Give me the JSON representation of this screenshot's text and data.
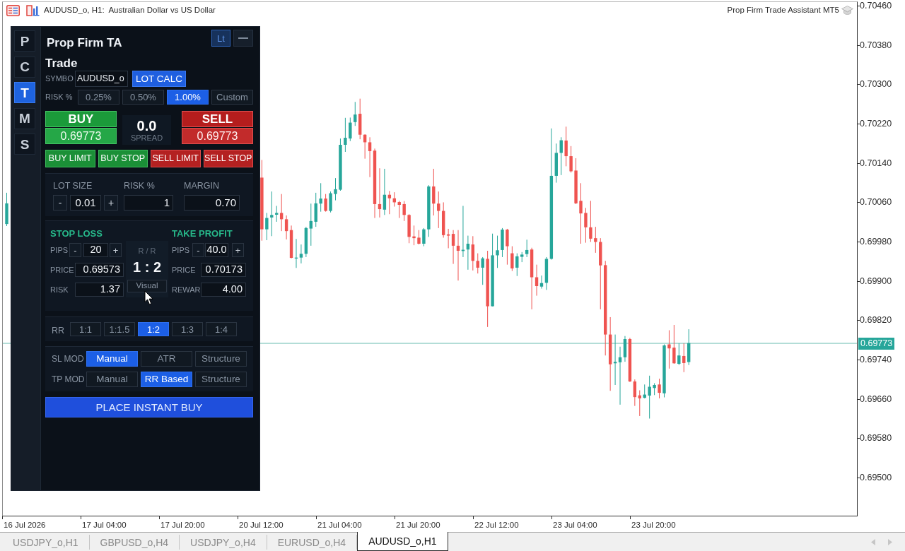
{
  "chart": {
    "title": "AUDUSD_o, H1:  Australian Dollar vs US Dollar",
    "expert_name": "Prop Firm Trade Assistant MT5",
    "price_axis": {
      "labels": [
        "0.70460",
        "0.70380",
        "0.70300",
        "0.70220",
        "0.70140",
        "0.70060",
        "0.69980",
        "0.69900",
        "0.69820",
        "0.69740",
        "0.69660",
        "0.69580",
        "0.69500"
      ],
      "current_price": "0.69773"
    },
    "time_axis": {
      "labels": [
        "16 Jul 2026",
        "17 Jul 04:00",
        "17 Jul 20:00",
        "20 Jul 12:00",
        "21 Jul 04:00",
        "21 Jul 20:00",
        "22 Jul 12:00",
        "23 Jul 04:00",
        "23 Jul 20:00"
      ]
    }
  },
  "panel": {
    "side_tabs": [
      {
        "label": "P",
        "selected": false
      },
      {
        "label": "C",
        "selected": false
      },
      {
        "label": "T",
        "selected": true
      },
      {
        "label": "M",
        "selected": false
      },
      {
        "label": "S",
        "selected": false
      }
    ],
    "title": "Prop Firm TA",
    "theme_button": {
      "label": "Lt",
      "on": true
    },
    "section_title": "Trade",
    "symbol": {
      "label": "SYMBO",
      "value": "AUDUSD_o"
    },
    "lot_calc_button": "LOT CALC",
    "risk_presets": {
      "label": "RISK %",
      "options": [
        {
          "label": "0.25%",
          "selected": false
        },
        {
          "label": "0.50%",
          "selected": false
        },
        {
          "label": "1.00%",
          "selected": true
        },
        {
          "label": "Custom",
          "selected": false
        }
      ]
    },
    "buy": {
      "label": "BUY",
      "price": "0.69773"
    },
    "spread": {
      "value": "0.0",
      "label": "SPREAD"
    },
    "sell": {
      "label": "SELL",
      "price": "0.69773"
    },
    "pending_orders": [
      {
        "label": "BUY LIMIT",
        "kind": "buy"
      },
      {
        "label": "BUY STOP",
        "kind": "buy"
      },
      {
        "label": "SELL LIMIT",
        "kind": "sell"
      },
      {
        "label": "SELL STOP",
        "kind": "sell"
      }
    ],
    "position_size": {
      "lot_size": {
        "label": "LOT SIZE",
        "decrement": "-",
        "value": "0.01",
        "increment": "+"
      },
      "risk": {
        "label": "RISK %",
        "value": "1"
      },
      "margin": {
        "label": "MARGIN",
        "value": "0.70"
      }
    },
    "stop_loss": {
      "title": "STOP LOSS",
      "pips": {
        "label": "PIPS",
        "decrement": "-",
        "value": "20",
        "increment": "+"
      },
      "price": {
        "label": "PRICE",
        "value": "0.69573"
      },
      "amount": {
        "label": "RISK",
        "value": "1.37"
      }
    },
    "risk_reward": {
      "label": "R / R",
      "ratio": "1 : 2",
      "visual_button": "Visual"
    },
    "take_profit": {
      "title": "TAKE PROFIT",
      "pips": {
        "label": "PIPS",
        "decrement": "-",
        "value": "40.0",
        "increment": "+"
      },
      "price": {
        "label": "PRICE",
        "value": "0.70173"
      },
      "amount": {
        "label": "REWAR",
        "value": "4.00"
      }
    },
    "rr_presets": {
      "label": "RR",
      "options": [
        {
          "label": "1:1",
          "selected": false
        },
        {
          "label": "1:1.5",
          "selected": false
        },
        {
          "label": "1:2",
          "selected": true
        },
        {
          "label": "1:3",
          "selected": false
        },
        {
          "label": "1:4",
          "selected": false
        }
      ]
    },
    "sl_mode": {
      "label": "SL MOD",
      "options": [
        {
          "label": "Manual",
          "selected": true
        },
        {
          "label": "ATR",
          "selected": false
        },
        {
          "label": "Structure",
          "selected": false
        }
      ]
    },
    "tp_mode": {
      "label": "TP MOD",
      "options": [
        {
          "label": "Manual",
          "selected": false
        },
        {
          "label": "RR Based",
          "selected": true
        },
        {
          "label": "Structure",
          "selected": false
        }
      ]
    },
    "place_button": "PLACE INSTANT BUY"
  },
  "chart_tabs": [
    {
      "label": "USDJPY_o,H1",
      "selected": false
    },
    {
      "label": "GBPUSD_o,H4",
      "selected": false
    },
    {
      "label": "USDJPY_o,H4",
      "selected": false
    },
    {
      "label": "EURUSD_o,H4",
      "selected": false
    },
    {
      "label": "AUDUSD_o,H1",
      "selected": true
    }
  ]
}
